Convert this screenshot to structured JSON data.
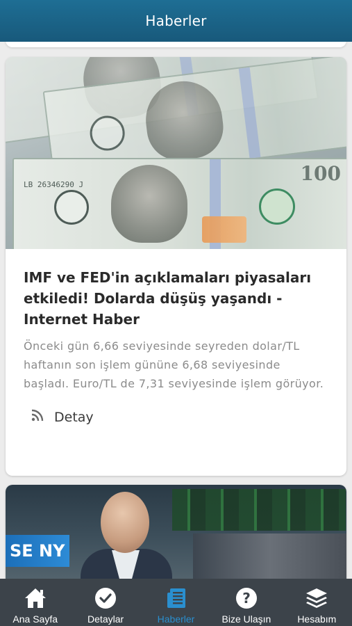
{
  "header": {
    "title": "Haberler"
  },
  "articles": [
    {
      "title": "IMF ve FED'in açıklamaları piyasaları etkiledi! Dolarda düşüş yaşandı - Internet Haber",
      "summary": "Önceki gün 6,66 seviyesinde seyreden dolar/TL haftanın son işlem gününe 6,68 seviyesinde başladı. Euro/TL de 7,31 seviyesinde işlem görüyor.",
      "detail_label": "Detay",
      "image": {
        "bill_number": "100",
        "serial": "LB 26346290 J",
        "sign_text": "SE NY"
      }
    }
  ],
  "tabbar": {
    "items": [
      {
        "label": "Ana Sayfa",
        "icon": "home-icon",
        "active": false
      },
      {
        "label": "Detaylar",
        "icon": "check-circle-icon",
        "active": false
      },
      {
        "label": "Haberler",
        "icon": "news-icon",
        "active": true
      },
      {
        "label": "Bize Ulaşın",
        "icon": "question-circle-icon",
        "active": false
      },
      {
        "label": "Hesabım",
        "icon": "layers-icon",
        "active": false
      }
    ]
  },
  "colors": {
    "header": "#18597b",
    "tabbar": "#3c434a",
    "active_tab": "#2a8fcf"
  }
}
